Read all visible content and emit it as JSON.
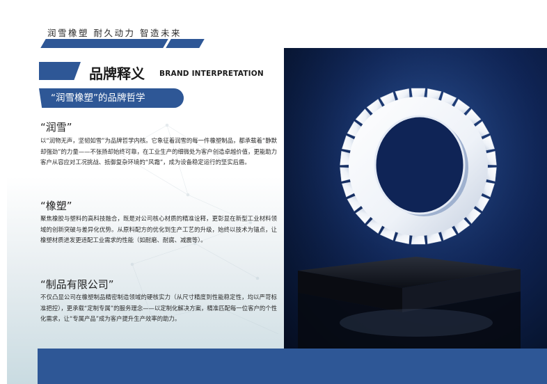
{
  "header": {
    "tagline": "润雪橡塑  耐久动力  智造未来"
  },
  "title": {
    "cn": "品牌释义",
    "en": "BRAND INTERPRETATION"
  },
  "subtitle_pill": "“润雪橡塑”的品牌哲学",
  "sections": [
    {
      "heading": "“润雪”",
      "body": "以“润物无声，坚韧如雪”为品牌哲学内核。它象征着润雪的每一件橡塑制品，都承载着“静默却强劲”的力量——不张扬却始终可靠，在工业生产的细微处为客户创造卓越价值，更能助力客户从容应对工况挑战、抵御复杂环境的“风霜”，成为设备稳定运行的坚实后盾。"
    },
    {
      "heading": "“橡塑”",
      "body": "聚焦橡胶与塑料的高科技融合，既是对公司核心材质的精准诠释，更彰显在新型工业材料领域的创新突破与差异化优势。从原料配方的优化到生产工艺的升级，始终以技术为锚点，让橡塑材质进发更适配工业需求的性能（如耐磨、耐腐、减震等）。"
    },
    {
      "heading": "“制品有限公司”",
      "body": "不仅凸显公司在橡塑制品精密制造领域的硬核实力（从尺寸精度到性能稳定性，均以严苛标准把控），更承载“定制专属”的服务理念——以定制化解决方案，精准匹配每一位客户的个性化需求，让“专属产品”成为客户提升生产效率的助力。"
    }
  ],
  "colors": {
    "accent": "#2e5796",
    "photo_bg": "#0f2456"
  },
  "image": {
    "subject": "white plastic gear on black glass pedestal"
  }
}
